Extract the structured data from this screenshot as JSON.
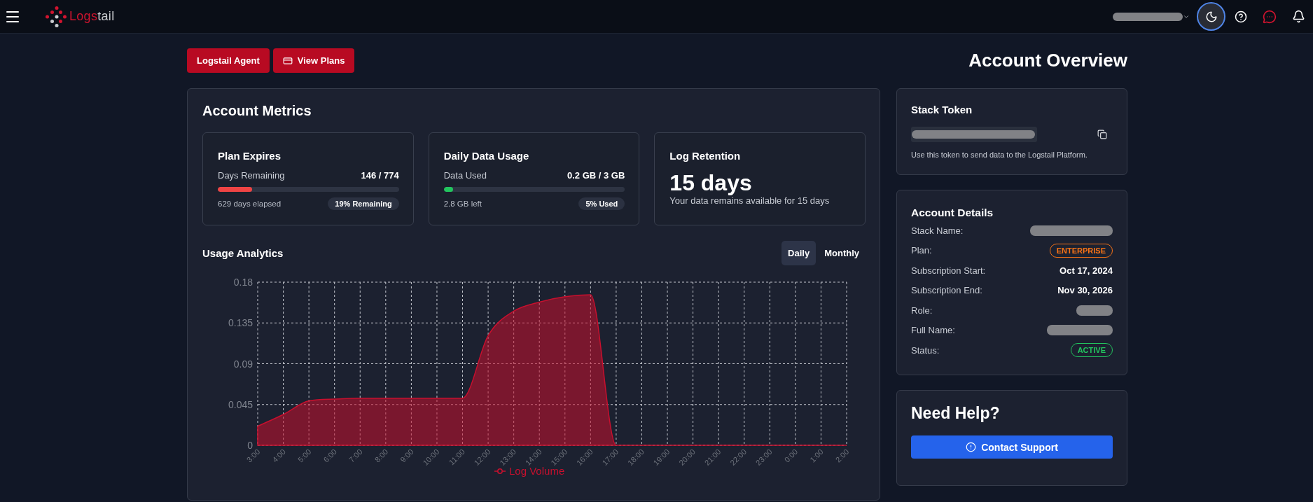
{
  "top_bar": {
    "logo": {
      "parts": [
        {
          "text": "Logs",
          "accent": true
        },
        {
          "text": "tail",
          "accent": false
        }
      ]
    }
  },
  "header": {
    "buttons": [
      {
        "label": "Logstail Agent",
        "kind": "plain"
      },
      {
        "label": "View Plans",
        "kind": "icon"
      }
    ],
    "title": "Account Overview"
  },
  "metrics": {
    "title": "Account Metrics",
    "cards": [
      {
        "kind": "progress",
        "title": "Plan Expires",
        "label": "Days Remaining",
        "reading": "146 / 774",
        "level": 0.19,
        "color": "#ef4444",
        "footnote": "629 days elapsed",
        "badge": "19% Remaining"
      },
      {
        "kind": "progress",
        "title": "Daily Data Usage",
        "label": "Data Used",
        "reading": "0.2 GB / 3 GB",
        "level": 0.05,
        "color": "#22c55e",
        "footnote": "2.8 GB left",
        "badge": "5% Used"
      },
      {
        "kind": "retention",
        "title": "Log Retention",
        "value": "15 days",
        "note": "Your data remains available for 15 days"
      }
    ]
  },
  "analytics": {
    "title": "Usage Analytics",
    "tabs": [
      {
        "label": "Daily",
        "selected": true
      },
      {
        "label": "Monthly",
        "selected": false
      }
    ],
    "chart_data": {
      "type": "area",
      "categories": [
        "3:00",
        "4:00",
        "5:00",
        "6:00",
        "7:00",
        "8:00",
        "9:00",
        "10:00",
        "11:00",
        "12:00",
        "13:00",
        "14:00",
        "15:00",
        "16:00",
        "17:00",
        "18:00",
        "19:00",
        "20:00",
        "21:00",
        "22:00",
        "23:00",
        "0:00",
        "1:00",
        "2:00"
      ],
      "series": [
        {
          "name": "Log Volume",
          "color": "#c8102e",
          "values": [
            0.021,
            0.034,
            0.049,
            0.051,
            0.052,
            0.052,
            0.052,
            0.052,
            0.052,
            0.121,
            0.148,
            0.158,
            0.164,
            0.166,
            0,
            0,
            0,
            0,
            0,
            0,
            0,
            0,
            0,
            0
          ]
        }
      ],
      "ylim": [
        0,
        0.18
      ],
      "yticks": [
        0,
        0.045,
        0.09,
        0.135,
        0.18
      ],
      "grid": true
    }
  },
  "stack_token": {
    "title": "Stack Token",
    "note": "Use this token to send data to the Logstail Platform."
  },
  "account_details": {
    "title": "Account Details",
    "rows": [
      {
        "label": "Stack Name:",
        "kind": "redacted"
      },
      {
        "label": "Plan:",
        "kind": "badge",
        "value": "ENTERPRISE",
        "color": "#f97316"
      },
      {
        "label": "Subscription Start:",
        "kind": "text",
        "value": "Oct 17, 2024"
      },
      {
        "label": "Subscription End:",
        "kind": "text",
        "value": "Nov 30, 2026"
      },
      {
        "label": "Role:",
        "kind": "redacted"
      },
      {
        "label": "Full Name:",
        "kind": "redacted"
      },
      {
        "label": "Status:",
        "kind": "badge",
        "value": "ACTIVE",
        "color": "#22c55e"
      }
    ]
  },
  "help": {
    "title": "Need Help?",
    "button": "Contact Support"
  }
}
